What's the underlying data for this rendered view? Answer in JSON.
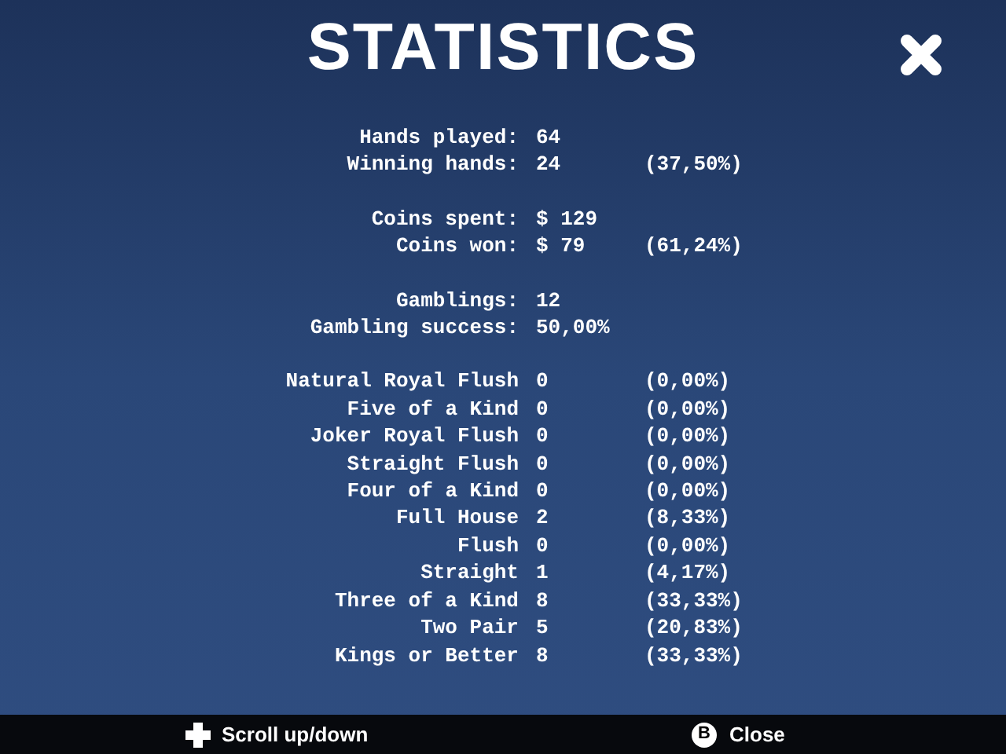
{
  "title": "STATISTICS",
  "groups": [
    {
      "rows": [
        {
          "label": "Hands played:",
          "value": "64"
        },
        {
          "label": "Winning hands:",
          "value": "24",
          "percent": "(37,50%)"
        }
      ]
    },
    {
      "rows": [
        {
          "label": "Coins spent:",
          "value": "$ 129"
        },
        {
          "label": "Coins won:",
          "value": "$ 79",
          "percent": "(61,24%)"
        }
      ]
    },
    {
      "rows": [
        {
          "label": "Gamblings:",
          "value": "12"
        },
        {
          "label": "Gambling success:",
          "value": "50,00%"
        }
      ]
    },
    {
      "rows": [
        {
          "label": "Natural Royal Flush",
          "value": "0",
          "percent": "(0,00%)"
        },
        {
          "label": "Five of a Kind",
          "value": "0",
          "percent": "(0,00%)"
        },
        {
          "label": "Joker Royal Flush",
          "value": "0",
          "percent": "(0,00%)"
        },
        {
          "label": "Straight Flush",
          "value": "0",
          "percent": "(0,00%)"
        },
        {
          "label": "Four of a Kind",
          "value": "0",
          "percent": "(0,00%)"
        },
        {
          "label": "Full House",
          "value": "2",
          "percent": "(8,33%)"
        },
        {
          "label": "Flush",
          "value": "0",
          "percent": "(0,00%)"
        },
        {
          "label": "Straight",
          "value": "1",
          "percent": "(4,17%)"
        },
        {
          "label": "Three of a Kind",
          "value": "8",
          "percent": "(33,33%)"
        },
        {
          "label": "Two Pair",
          "value": "5",
          "percent": "(20,83%)"
        },
        {
          "label": "Kings or Better",
          "value": "8",
          "percent": "(33,33%)"
        }
      ]
    }
  ],
  "footer": {
    "scroll_hint": "Scroll up/down",
    "close_key": "B",
    "close_label": "Close"
  }
}
